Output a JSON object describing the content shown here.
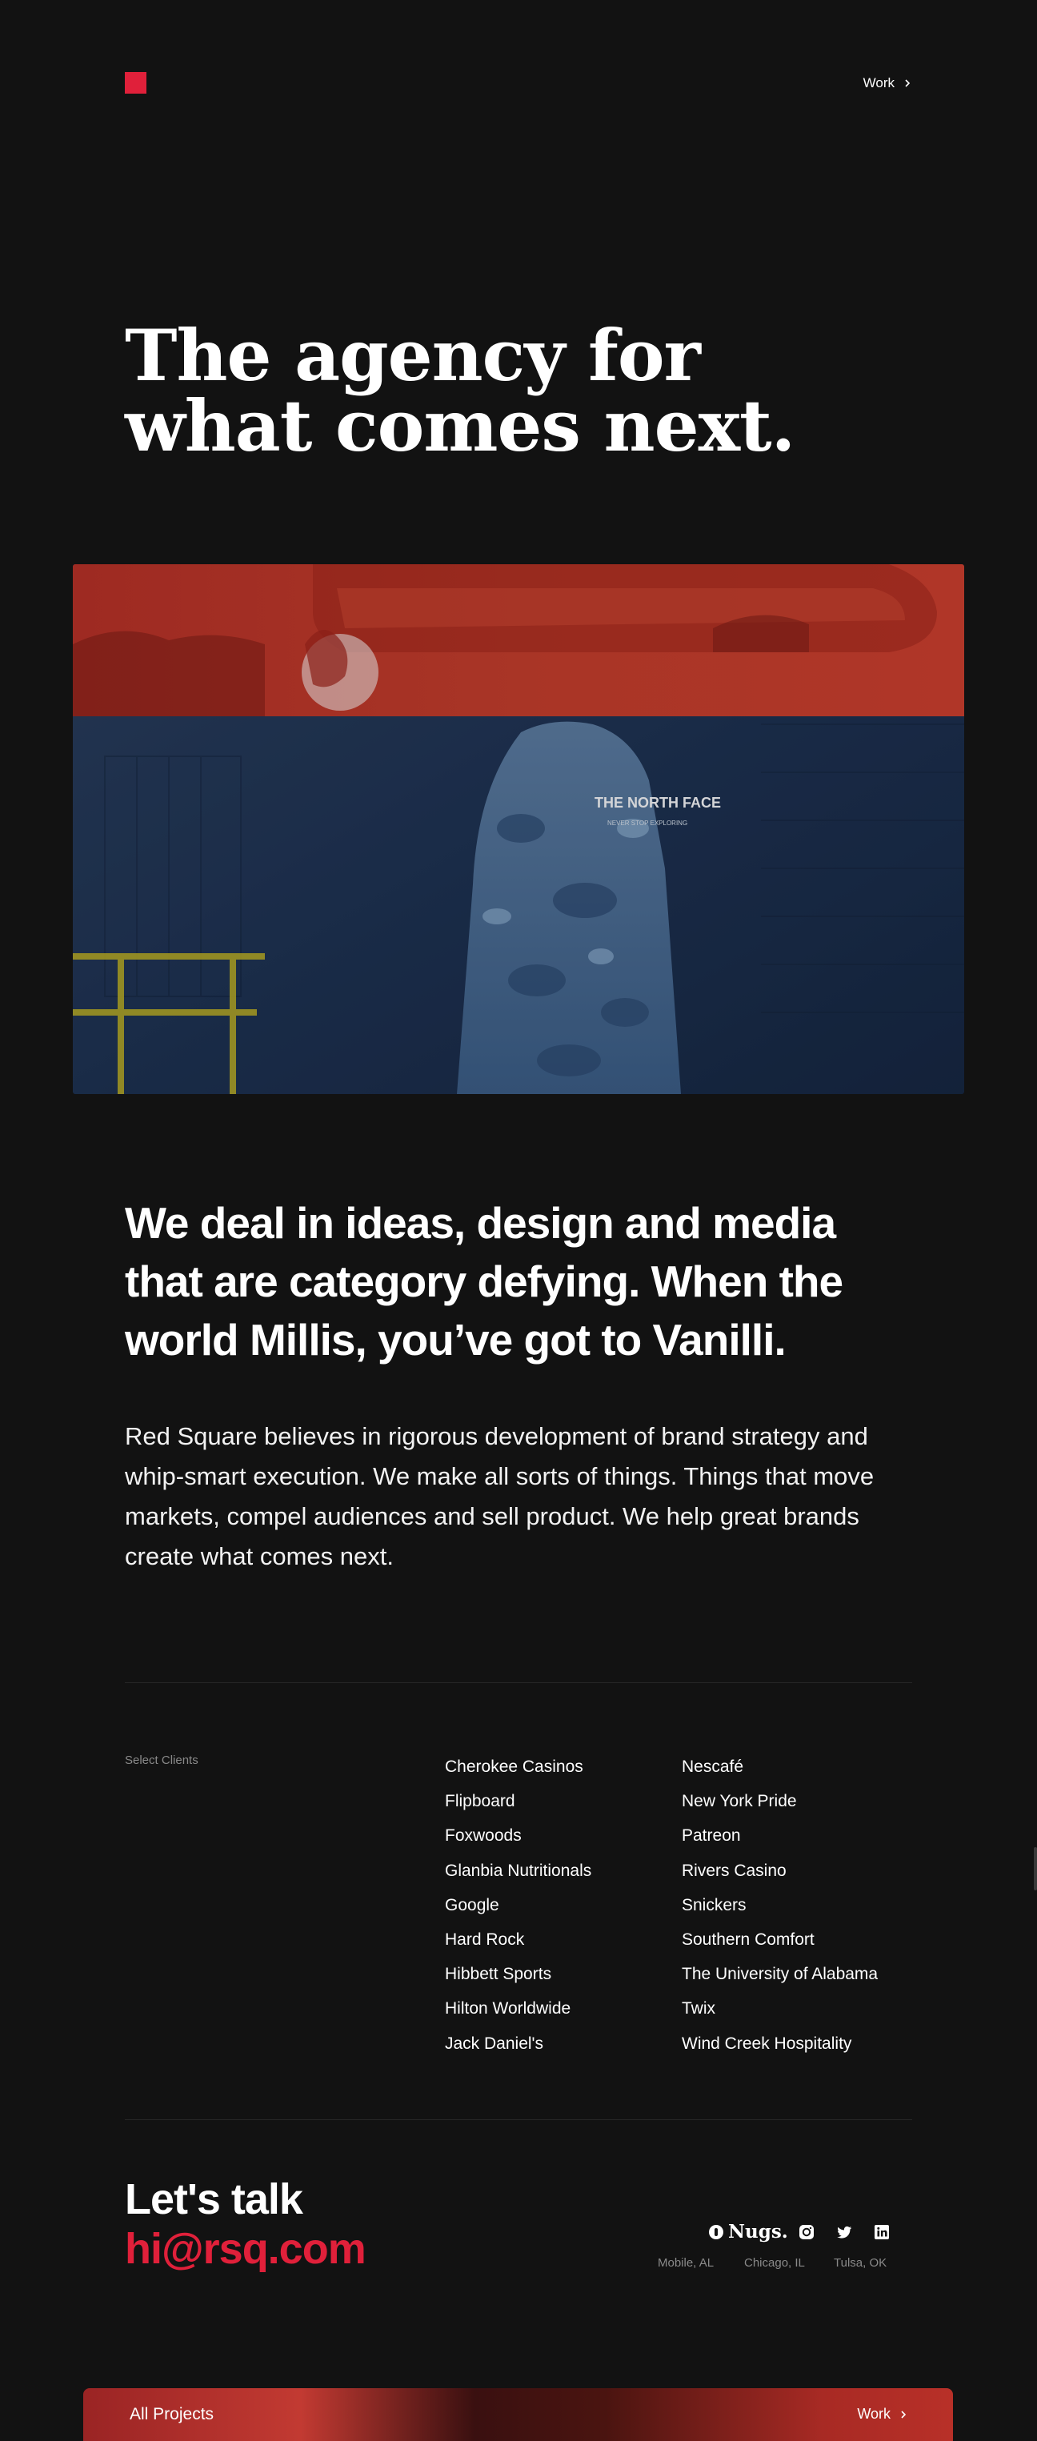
{
  "header": {
    "logo_alt": "Red Square",
    "nav_work_label": "Work"
  },
  "hero": {
    "title_line1": "The agency for",
    "title_line2": "what comes next."
  },
  "media": {
    "hoodie_text_1": "THE NORTH FACE",
    "hoodie_text_2": "NEVER STOP EXPLORING"
  },
  "statement": {
    "text": "We deal in ideas, design and media that are category defying. When the world Millis, you’ve got to Vanilli."
  },
  "about": {
    "text": "Red Square believes in rigorous development of brand strategy and whip-smart execution. We make all sorts of things. Things that move markets, compel audiences and sell product. We help great brands create what comes next."
  },
  "clients": {
    "label": "Select Clients",
    "column1": [
      "Cherokee Casinos",
      "Flipboard",
      "Foxwoods",
      "Glanbia Nutritionals",
      "Google",
      "Hard Rock",
      "Hibbett Sports",
      "Hilton Worldwide",
      "Jack Daniel's"
    ],
    "column2": [
      "Nescafé",
      "New York Pride",
      "Patreon",
      "Rivers Casino",
      "Snickers",
      "Southern Comfort",
      "The University of Alabama",
      "Twix",
      "Wind Creek Hospitality"
    ]
  },
  "contact": {
    "heading": "Let's talk",
    "email": "hi@rsq.com"
  },
  "social": {
    "nugs_label": "Nugs.",
    "icons": [
      "instagram-icon",
      "twitter-icon",
      "linkedin-icon"
    ]
  },
  "locations": [
    "Mobile, AL",
    "Chicago, IL",
    "Tulsa, OK"
  ],
  "bottom_bar": {
    "label": "All Projects",
    "work_label": "Work"
  },
  "colors": {
    "background": "#121212",
    "accent": "#e0203a",
    "text": "#ffffff",
    "muted": "#8a8a8a"
  }
}
